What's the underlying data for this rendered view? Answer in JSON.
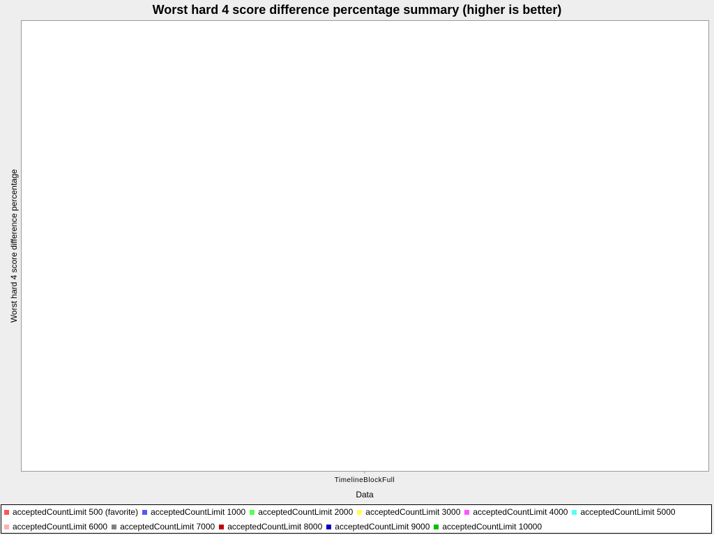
{
  "chart_data": {
    "type": "bar",
    "title": "Worst hard 4 score difference percentage summary (higher is better)",
    "xlabel": "Data",
    "ylabel": "Worst hard 4 score difference percentage",
    "categories": [
      "TimelineBlockFull"
    ],
    "series": [
      {
        "name": "acceptedCountLimit 500 (favorite)",
        "color": "#ff5555",
        "values": []
      },
      {
        "name": "acceptedCountLimit 1000",
        "color": "#5555ff",
        "values": []
      },
      {
        "name": "acceptedCountLimit 2000",
        "color": "#55ff55",
        "values": []
      },
      {
        "name": "acceptedCountLimit 3000",
        "color": "#ffff55",
        "values": []
      },
      {
        "name": "acceptedCountLimit 4000",
        "color": "#ff55ff",
        "values": []
      },
      {
        "name": "acceptedCountLimit 5000",
        "color": "#55ffff",
        "values": []
      },
      {
        "name": "acceptedCountLimit 6000",
        "color": "#ffafaf",
        "values": []
      },
      {
        "name": "acceptedCountLimit 7000",
        "color": "#808080",
        "values": []
      },
      {
        "name": "acceptedCountLimit 8000",
        "color": "#c00000",
        "values": []
      },
      {
        "name": "acceptedCountLimit 9000",
        "color": "#0000c0",
        "values": []
      },
      {
        "name": "acceptedCountLimit 10000",
        "color": "#00c000",
        "values": []
      }
    ],
    "grid": false,
    "legend_position": "bottom"
  }
}
